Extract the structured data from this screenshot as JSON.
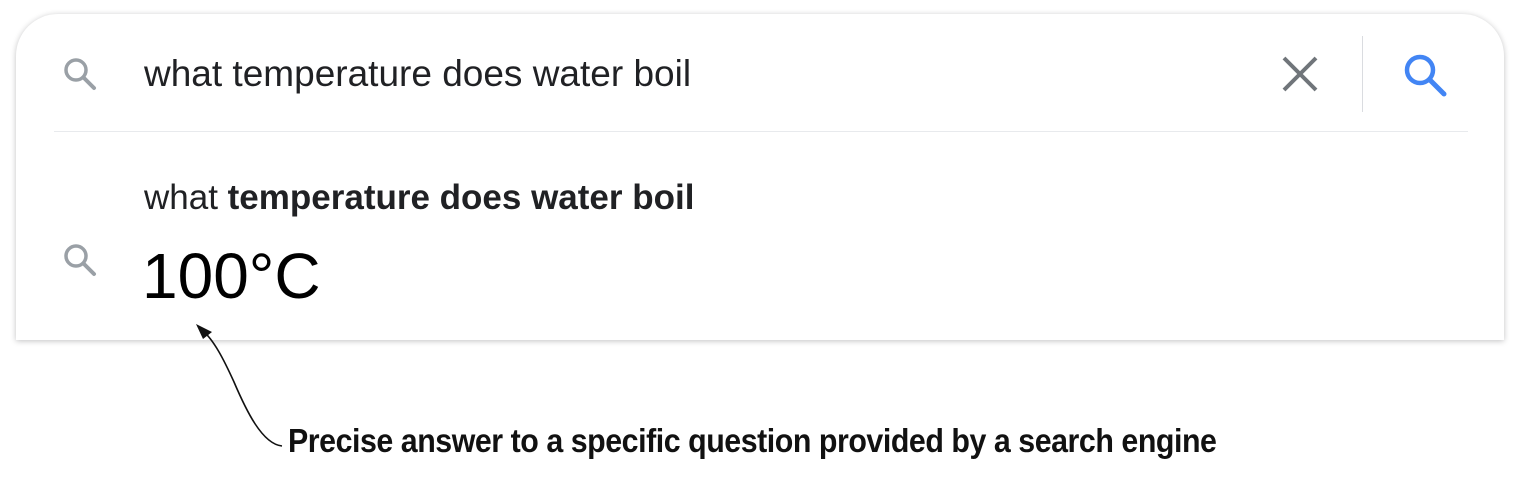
{
  "search": {
    "query": "what temperature does water boil",
    "lead_icon": "search-icon",
    "clear_icon": "close-icon",
    "submit_icon": "search-icon"
  },
  "suggestion": {
    "prefix": "what ",
    "bold": "temperature does water boil",
    "answer": "100°C",
    "icon": "search-icon"
  },
  "annotation": {
    "callout": "Precise answer to a specific question provided by a search engine"
  },
  "colors": {
    "icon_gray": "#9aa0a6",
    "clear_gray": "#70757a",
    "accent_blue": "#4285f4",
    "text": "#202124"
  }
}
